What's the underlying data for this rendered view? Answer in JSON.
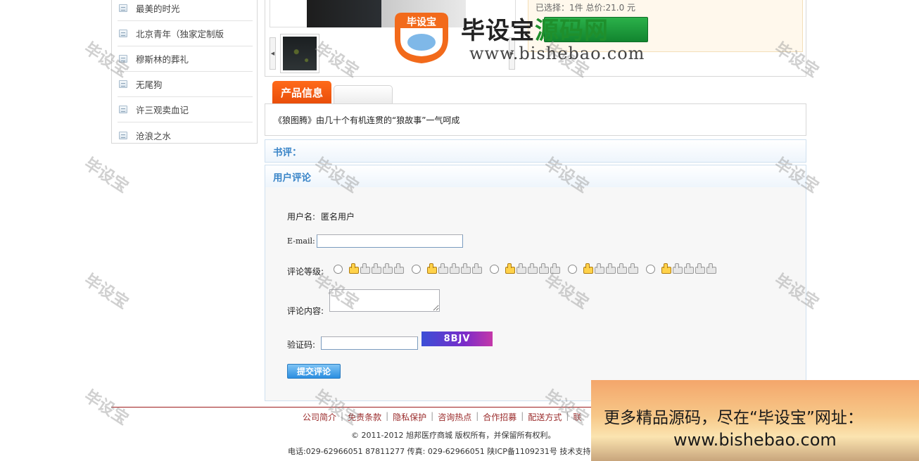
{
  "sidebar": {
    "items": [
      {
        "label": "最美的时光"
      },
      {
        "label": "北京青年（独家定制版"
      },
      {
        "label": "穆斯林的葬礼"
      },
      {
        "label": "无尾狗"
      },
      {
        "label": "许三观卖血记"
      },
      {
        "label": "沧浪之水"
      }
    ]
  },
  "product": {
    "order_summary": "已选择：1件 总价:21.0 元"
  },
  "tabs": {
    "active": "产品信息",
    "inactive": ""
  },
  "description": "《狼图腾》由几十个有机连贯的“狼故事”一气呵成",
  "sections": {
    "review_title": "书评：",
    "comments_title": "用户评论"
  },
  "comment_form": {
    "username_label": "用户名:",
    "username_value": "匿名用户",
    "email_label": "E-mail:",
    "email_value": "",
    "rating_label": "评论等级:",
    "rating_options": [
      1,
      2,
      3,
      4,
      5
    ],
    "content_label": "评论内容:",
    "captcha_label": "验证码:",
    "captcha_value": "",
    "captcha_text": "8BJV",
    "submit_label": "提交评论"
  },
  "footer": {
    "links": [
      "公司简介",
      "免责条款",
      "隐私保护",
      "咨询热点",
      "合作招募",
      "配送方式",
      "联"
    ],
    "copyright": "© 2011-2012 旭邦医疗商城 版权所有，并保留所有权利。",
    "contact": "电话:029-62966051 87811277 传真: 029-62966051 陕ICP备1109231号 技术支持:"
  },
  "watermark": {
    "text": "毕设宝"
  },
  "logo": {
    "badge_text": "毕设宝",
    "name_dark": "毕设宝",
    "name_accent": "源码网",
    "url": "www.bishebao.com"
  },
  "ad": {
    "line1": "更多精品源码，尽在“毕设宝”网址：",
    "line2": "www.bishebao.com"
  },
  "colors": {
    "tab_orange": "#ff6a1a",
    "section_blue": "#3a85c8",
    "footer_rule": "#9e1c1c"
  }
}
